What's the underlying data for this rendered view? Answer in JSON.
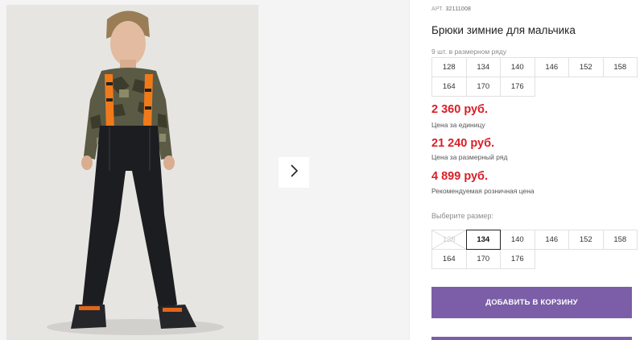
{
  "product": {
    "sku_label": "АРТ.",
    "sku_number": "32111008",
    "title": "Брюки зимние для мальчика"
  },
  "pack": {
    "note": "9 шт. в размерном ряду",
    "sizes": [
      "128",
      "134",
      "140",
      "146",
      "152",
      "158",
      "164",
      "170",
      "176"
    ]
  },
  "prices": {
    "unit_price": "2 360 руб.",
    "unit_label": "Цена за единицу",
    "pack_price": "21 240 руб.",
    "pack_label": "Цена за размерный ряд",
    "retail_price": "4 899 руб.",
    "retail_label": "Рекомендуемая розничная цена"
  },
  "picker": {
    "label": "Выберите размер:",
    "sizes": [
      "128",
      "134",
      "140",
      "146",
      "152",
      "158",
      "164",
      "170",
      "176"
    ],
    "selected": "134",
    "unavailable": "128"
  },
  "cart": {
    "add_label": "ДОБАВИТЬ В КОРЗИНУ"
  },
  "colors": {
    "price": "#d81f26",
    "accent": "#7b5ea7"
  },
  "icons": {
    "next": "chevron-right-icon"
  }
}
